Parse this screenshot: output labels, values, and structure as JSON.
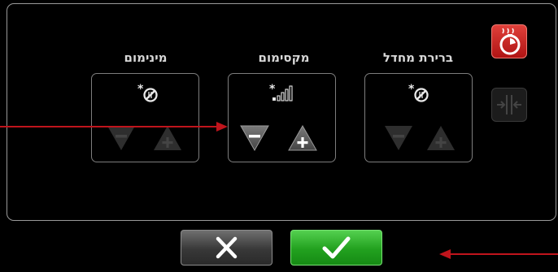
{
  "columns": [
    {
      "label": "ברירת מחדל",
      "mode_icon": "snowflake-off-icon",
      "state": "disabled"
    },
    {
      "label": "מקסימום",
      "mode_icon": "signal-bars-icon",
      "state": "active"
    },
    {
      "label": "מינימום",
      "mode_icon": "snowflake-off-icon",
      "state": "disabled"
    }
  ],
  "side_buttons": [
    {
      "icon": "steam-timer-icon",
      "color": "#c8201c"
    },
    {
      "icon": "compress-arrows-icon",
      "state": "disabled"
    }
  ],
  "actions": {
    "cancel_icon": "x-icon",
    "confirm_icon": "checkmark-icon",
    "cancel_color": "#3a3a3a",
    "confirm_color": "#22a11f"
  },
  "annotation_color": "#c0141c"
}
